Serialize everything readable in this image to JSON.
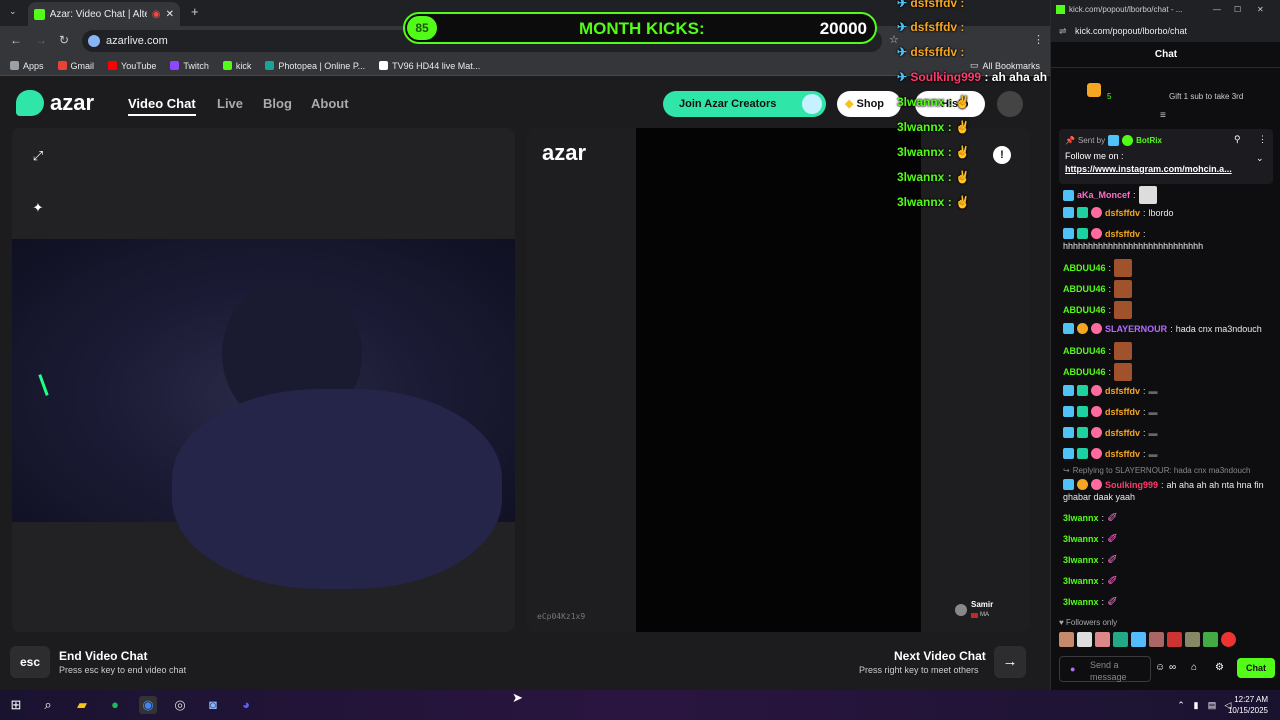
{
  "browser": {
    "tab_title": "Azar: Video Chat | Alternati...",
    "url": "azarlive.com",
    "bookmarks": [
      {
        "label": "Apps",
        "color": "#9aa0a6"
      },
      {
        "label": "Gmail",
        "color": "#ea4335"
      },
      {
        "label": "YouTube",
        "color": "#ff0000"
      },
      {
        "label": "Twitch",
        "color": "#9146ff"
      },
      {
        "label": "kick",
        "color": "#53fc18"
      },
      {
        "label": "Photopea | Online P...",
        "color": "#18a497"
      },
      {
        "label": "TV96 HD44 live Mat...",
        "color": "#ffffff"
      }
    ],
    "all_bookmarks": "All Bookmarks"
  },
  "azar": {
    "logo": "azar",
    "nav": [
      "Video Chat",
      "Live",
      "Blog",
      "About"
    ],
    "creators_button": "Join Azar Creators",
    "shop_button": "Shop",
    "history_button": "Histo",
    "watermark": "azar",
    "session_code": "eCp04Kz1x9",
    "partner_name": "Samir",
    "partner_country": "MA",
    "end_title": "End Video Chat",
    "end_subtitle": "Press esc key to end video chat",
    "esc_key": "esc",
    "next_title": "Next Video Chat",
    "next_subtitle": "Press right key to meet others"
  },
  "overlay": {
    "level": "85",
    "title": "MONTH KICKS:",
    "target": "20000",
    "chat": [
      {
        "user": "dsfsffdv",
        "color": "#f5a623"
      },
      {
        "user": "dsfsffdv",
        "color": "#f5a623"
      },
      {
        "user": "dsfsffdv",
        "color": "#f5a623"
      },
      {
        "user": "Soulking999",
        "color": "#ff3b6b",
        "text": "ah aha ah ah nta hna fin ghabar daak yaah"
      },
      {
        "user": "3lwannx",
        "color": "#53fc18"
      },
      {
        "user": "3lwannx",
        "color": "#53fc18"
      },
      {
        "user": "3lwannx",
        "color": "#53fc18"
      },
      {
        "user": "3lwannx",
        "color": "#53fc18"
      },
      {
        "user": "3lwannx",
        "color": "#53fc18"
      }
    ]
  },
  "kick": {
    "window_title": "kick.com/popout/lborbo/chat - ...",
    "url": "kick.com/popout/lborbo/chat",
    "header": "Chat",
    "gift_count": "5",
    "gift_text": "Gift 1 sub to take 3rd",
    "pinned_by_label": "Sent by",
    "pinned_by": "BotRix",
    "pinned_text": "Follow me on :",
    "pinned_link": "https://www.instagram.com/mohcin.a...",
    "messages": [
      {
        "user": "aKa_Moncef",
        "color": "#ff6ec7",
        "text": ""
      },
      {
        "user": "dsfsffdv",
        "color": "#f5a623",
        "text": "lbordo"
      },
      {
        "user": "dsfsffdv",
        "color": "#f5a623",
        "text": ""
      },
      {
        "user": "",
        "color": "#e8eaed",
        "text": "hhhhhhhhhhhhhhhhhhhhhhhhhhhh"
      },
      {
        "user": "ABDUU46",
        "color": "#53fc18",
        "text": ""
      },
      {
        "user": "ABDUU46",
        "color": "#53fc18",
        "text": ""
      },
      {
        "user": "ABDUU46",
        "color": "#53fc18",
        "text": ""
      },
      {
        "user": "SLAYERNOUR",
        "color": "#b46cff",
        "text": "hada cnx ma3ndouch"
      },
      {
        "user": "ABDUU46",
        "color": "#53fc18",
        "text": ""
      },
      {
        "user": "ABDUU46",
        "color": "#53fc18",
        "text": ""
      },
      {
        "user": "dsfsffdv",
        "color": "#f5a623",
        "text": ""
      },
      {
        "user": "dsfsffdv",
        "color": "#f5a623",
        "text": ""
      },
      {
        "user": "dsfsffdv",
        "color": "#f5a623",
        "text": ""
      },
      {
        "user": "dsfsffdv",
        "color": "#f5a623",
        "text": ""
      }
    ],
    "reply_label": "Replying to SLAYERNOUR: hada cnx ma3ndouch",
    "reply_user": "Soulking999",
    "reply_text": "ah aha ah ah nta hna fin",
    "reply_text2": "ghabar daak yaah",
    "tail_messages": [
      {
        "user": "3lwannx",
        "color": "#53fc18"
      },
      {
        "user": "3lwannx",
        "color": "#53fc18"
      },
      {
        "user": "3lwannx",
        "color": "#53fc18"
      },
      {
        "user": "3lwannx",
        "color": "#53fc18"
      },
      {
        "user": "3lwannx",
        "color": "#53fc18"
      }
    ],
    "followers_only": "Followers only",
    "input_placeholder": "Send a message",
    "chat_button": "Chat"
  },
  "taskbar": {
    "time": "12:27 AM",
    "date": "10/15/2025"
  }
}
